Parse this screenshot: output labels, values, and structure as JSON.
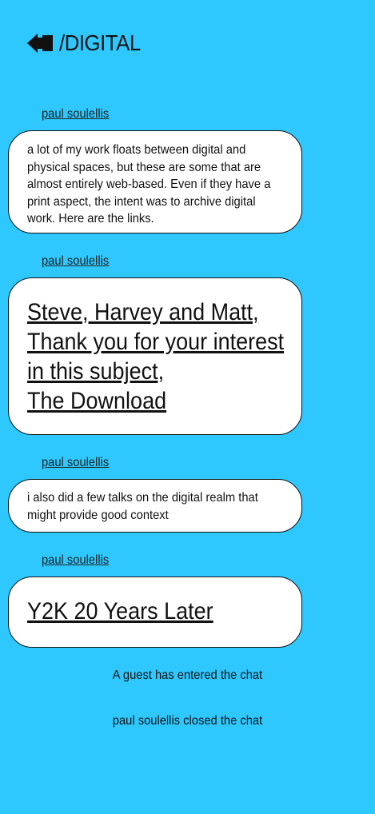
{
  "header": {
    "back_icon": "back-arrow-icon",
    "title": "/DIGITAL"
  },
  "messages": [
    {
      "author": "paul soulellis",
      "text": "a lot of my work floats between digital and physical spaces, but these are some that are almost entirely web-based. Even if they have a print aspect, the intent was to archive digital work. Here are the links."
    },
    {
      "author": "paul soulellis",
      "links": [
        "Steve, Harvey and Matt,",
        "Thank you for your interest",
        "in this subject,",
        "The Download"
      ]
    },
    {
      "author": "paul soulellis",
      "text": "i also did a few talks on the digital realm that might provide good context"
    },
    {
      "author": "paul soulellis",
      "links": [
        "Y2K 20 Years Later"
      ]
    }
  ],
  "system_messages": [
    "A guest has entered the chat",
    "paul soulellis closed the chat"
  ],
  "colors": {
    "background": "#2ec8ff",
    "bubble": "#ffffff",
    "text": "#111111"
  }
}
